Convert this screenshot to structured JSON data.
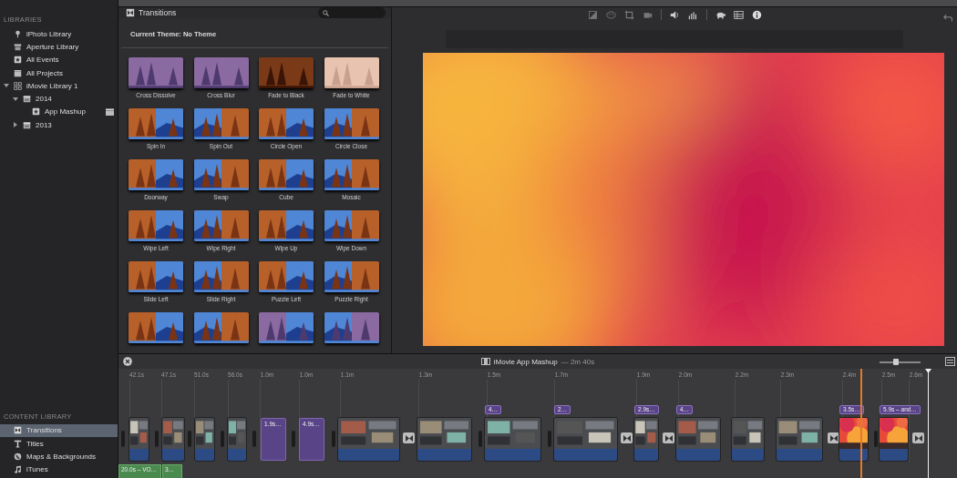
{
  "sidebar": {
    "libraries_heading": "LIBRARIES",
    "libraries": [
      {
        "label": "iPhoto Library",
        "kind": "iphoto",
        "selected": false
      },
      {
        "label": "Aperture Library",
        "kind": "aperture",
        "selected": false
      },
      {
        "label": "All Events",
        "kind": "events",
        "selected": false
      },
      {
        "label": "All Projects",
        "kind": "projects",
        "selected": false
      },
      {
        "label": "iMovie Library 1",
        "kind": "library",
        "selected": false,
        "expanded": true,
        "children": [
          {
            "label": "2014",
            "kind": "year",
            "selected": false,
            "expanded": true,
            "children": [
              {
                "label": "App Mashup",
                "kind": "event",
                "selected": false
              }
            ]
          },
          {
            "label": "2013",
            "kind": "year",
            "selected": false,
            "expanded": false
          }
        ]
      }
    ],
    "content_heading": "CONTENT LIBRARY",
    "content": [
      {
        "label": "Transitions",
        "kind": "transitions",
        "selected": true
      },
      {
        "label": "Titles",
        "kind": "titles",
        "selected": false
      },
      {
        "label": "Maps & Backgrounds",
        "kind": "maps",
        "selected": false
      },
      {
        "label": "iTunes",
        "kind": "itunes",
        "selected": false
      }
    ]
  },
  "browser": {
    "title": "Transitions",
    "theme": "Current Theme: No Theme",
    "items": [
      {
        "kind": "transition",
        "name": "Cross Dissolve"
      },
      {
        "kind": "transition",
        "name": "Cross Blur"
      },
      {
        "kind": "transition",
        "name": "Fade to Black"
      },
      {
        "kind": "transition",
        "name": "Fade to White"
      },
      {
        "kind": "transition",
        "name": "Spin In"
      },
      {
        "kind": "transition",
        "name": "Spin Out"
      },
      {
        "kind": "transition",
        "name": "Circle Open"
      },
      {
        "kind": "transition",
        "name": "Circle Close"
      },
      {
        "kind": "transition",
        "name": "Doorway"
      },
      {
        "kind": "transition",
        "name": "Swap"
      },
      {
        "kind": "transition",
        "name": "Cube"
      },
      {
        "kind": "transition",
        "name": "Mosaic"
      },
      {
        "kind": "transition",
        "name": "Wipe Left"
      },
      {
        "kind": "transition",
        "name": "Wipe Right"
      },
      {
        "kind": "transition",
        "name": "Wipe Up"
      },
      {
        "kind": "transition",
        "name": "Wipe Down"
      },
      {
        "kind": "transition",
        "name": "Slide Left"
      },
      {
        "kind": "transition",
        "name": "Slide Right"
      },
      {
        "kind": "transition",
        "name": "Puzzle Left"
      },
      {
        "kind": "transition",
        "name": "Puzzle Right"
      },
      {
        "kind": "picture"
      },
      {
        "kind": "picture"
      },
      {
        "kind": "picture"
      },
      {
        "kind": "picture"
      }
    ]
  },
  "timeline": {
    "title": "iMovie App Mashup",
    "duration": "— 2m 40s",
    "zoom": {
      "level": 0.4
    },
    "ticks": [
      "42.1s",
      "47.1s",
      "51.0s",
      "56.0s",
      "1.0m",
      "1.0m",
      "1.1m",
      "1.3m",
      "1.5m",
      "1.7m",
      "1.9m",
      "2.0m",
      "2.2m",
      "2.3m",
      "2.4m",
      "2.5m",
      "2.6m"
    ],
    "clips": [
      {
        "kind": "handle"
      },
      {
        "kind": "video"
      },
      {
        "kind": "handle"
      },
      {
        "kind": "video"
      },
      {
        "kind": "handle"
      },
      {
        "kind": "video"
      },
      {
        "kind": "handle"
      },
      {
        "kind": "video"
      },
      {
        "kind": "handle"
      },
      {
        "kind": "title",
        "label": "1.9s…"
      },
      {
        "kind": "handle"
      },
      {
        "kind": "title",
        "label": "4.9s…"
      },
      {
        "kind": "handle"
      },
      {
        "kind": "video"
      },
      {
        "kind": "transition"
      },
      {
        "kind": "video"
      },
      {
        "kind": "handle"
      },
      {
        "kind": "video",
        "label": "4…"
      },
      {
        "kind": "handle"
      },
      {
        "kind": "video",
        "label": "2…"
      },
      {
        "kind": "transition"
      },
      {
        "kind": "video",
        "label": "2.9s…"
      },
      {
        "kind": "transition"
      },
      {
        "kind": "video",
        "label": "4…"
      },
      {
        "kind": "video"
      },
      {
        "kind": "video"
      },
      {
        "kind": "transition"
      },
      {
        "kind": "gradient",
        "label": "3.5s…"
      },
      {
        "kind": "handle"
      },
      {
        "kind": "gradient",
        "label": "5.9s – and…"
      },
      {
        "kind": "transition"
      }
    ],
    "audio": [
      {
        "label": "20.0s – VO…"
      },
      {
        "label": "3…"
      }
    ]
  }
}
